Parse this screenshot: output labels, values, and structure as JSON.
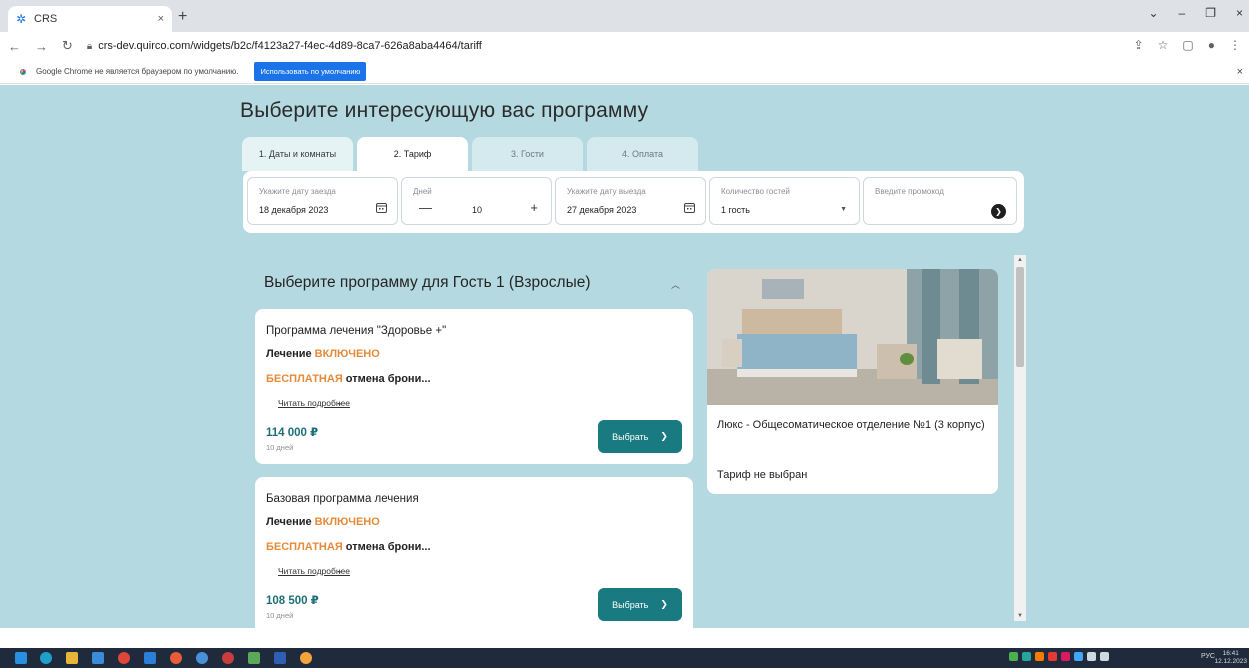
{
  "browser": {
    "tab_title": "CRS",
    "tab_close": "×",
    "new_tab": "+",
    "url": "crs-dev.quirco.com/widgets/b2c/f4123a27-f4ec-4d89-8ca7-626a8aba4464/tariff",
    "window_controls": [
      "⌄",
      "–",
      "❐",
      "×"
    ]
  },
  "infobar": {
    "message": "Google Chrome не является браузером по умолчанию.",
    "button": "Использовать по умолчанию",
    "dismiss": "×"
  },
  "page": {
    "title": "Выберите интересующую вас программу",
    "steps": [
      {
        "label": "1. Даты и комнаты"
      },
      {
        "label": "2. Тариф"
      },
      {
        "label": "3. Гости"
      },
      {
        "label": "4. Оплата"
      }
    ],
    "filters": {
      "checkin_label": "Укажите дату заезда",
      "checkin_value": "18 декабря 2023",
      "days_label": "Дней",
      "days_value": "10",
      "days_minus": "—",
      "days_plus": "+",
      "checkout_label": "Укажите дату выезда",
      "checkout_value": "27 декабря 2023",
      "guests_label": "Количество гостей",
      "guests_value": "1 гость",
      "promo_placeholder": "Введите промокод"
    },
    "section_title": "Выберите программу для Гость 1 (Взрослые)",
    "programs": [
      {
        "name": "Программа лечения \"Здоровье +\"",
        "treatment_prefix": "Лечение ",
        "treatment_accent": "ВКЛЮЧЕНО",
        "cancel_accent": "БЕСПЛАТНАЯ",
        "cancel_suffix": " отмена брони...",
        "more": "Читать подробнее",
        "price": "114 000 ₽",
        "duration": "10 дней",
        "select": "Выбрать"
      },
      {
        "name": "Базовая программа лечения",
        "treatment_prefix": "Лечение ",
        "treatment_accent": "ВКЛЮЧЕНО",
        "cancel_accent": "БЕСПЛАТНАЯ",
        "cancel_suffix": " отмена брони...",
        "more": "Читать подробнее",
        "price": "108 500 ₽",
        "duration": "10 дней",
        "select": "Выбрать"
      }
    ],
    "room": {
      "name": "Люкс - Общесоматическое отделение №1 (3 корпус)",
      "tariff_status": "Тариф не выбран"
    }
  },
  "taskbar": {
    "lang": "РУС",
    "time": "16:41",
    "date": "12.12.2023"
  },
  "colors": {
    "page_bg": "#b4d9e0",
    "accent_orange": "#e58a3a",
    "price_teal": "#1d6f7a",
    "button_teal": "#1a7a82",
    "chrome_blue": "#1a73e8"
  }
}
